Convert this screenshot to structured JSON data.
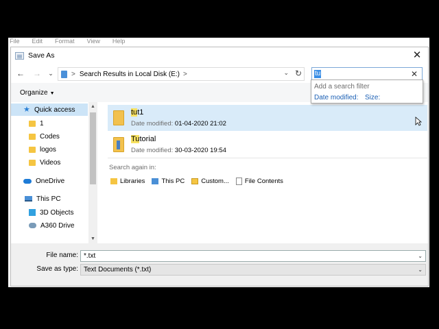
{
  "parent_app": {
    "menu": [
      "File",
      "Edit",
      "Format",
      "View",
      "Help"
    ]
  },
  "dialog": {
    "title": "Save As",
    "close_label": "✕"
  },
  "navbar": {
    "back": "←",
    "forward": "→",
    "recent": "⌄",
    "up": "↑",
    "address_sep": ">",
    "address_text": "Search Results in Local Disk (E:)",
    "address_sep2": ">",
    "refresh": "↻"
  },
  "search": {
    "value": "tu",
    "clear": "✕",
    "filter_title": "Add a search filter",
    "filter_options": [
      "Date modified:",
      "Size:"
    ]
  },
  "toolbar": {
    "organize": "Organize",
    "caret": "▼"
  },
  "nav_pane": {
    "items": [
      {
        "label": "Quick access",
        "icon": "star-icon"
      },
      {
        "label": "1",
        "icon": "folder-icon"
      },
      {
        "label": "Codes",
        "icon": "folder-icon"
      },
      {
        "label": "logos",
        "icon": "folder-icon"
      },
      {
        "label": "Videos",
        "icon": "folder-icon"
      },
      {
        "label": "OneDrive",
        "icon": "cloud-icon"
      },
      {
        "label": "This PC",
        "icon": "pc-icon"
      },
      {
        "label": "3D Objects",
        "icon": "cube-icon"
      },
      {
        "label": "A360 Drive",
        "icon": "drive-icon"
      }
    ],
    "scroll_up": "▲",
    "scroll_down": "▼"
  },
  "files": [
    {
      "name_hl": "tu",
      "name_rest": "t1",
      "meta_label": "Date modified:",
      "meta_value": "01-04-2020 21:02"
    },
    {
      "name_hl": "Tu",
      "name_rest": "torial",
      "meta_label": "Date modified:",
      "meta_value": "30-03-2020 19:54"
    }
  ],
  "search_again": {
    "label": "Search again in:",
    "items": [
      "Libraries",
      "This PC",
      "Custom...",
      "File Contents"
    ]
  },
  "bottom": {
    "file_name_label": "File name:",
    "file_name_value": "*.txt",
    "save_type_label": "Save as type:",
    "save_type_value": "Text Documents (*.txt)",
    "caret": "⌄"
  },
  "colors": {
    "accent": "#3a8ee6",
    "selection": "#cce4f7",
    "highlight": "#f7e160"
  }
}
